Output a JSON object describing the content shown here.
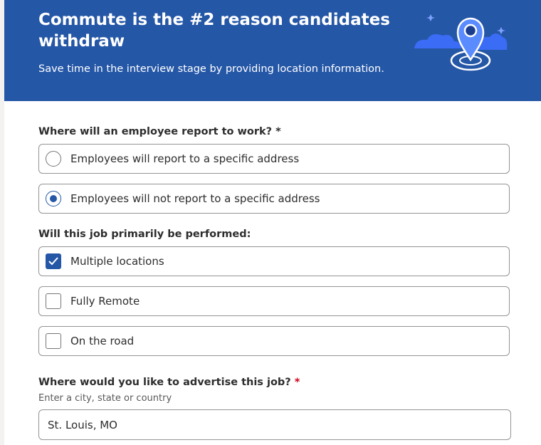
{
  "banner": {
    "title": "Commute is the #2 reason candidates withdraw",
    "subtitle": "Save time in the interview stage by providing location information.",
    "illustration": "location-pin-icon",
    "colors": {
      "background": "#2557a7",
      "pin": "#5b8cff",
      "cloud": "#3b6cf5"
    }
  },
  "report_question": {
    "label": "Where will an employee report to work?",
    "required_marker": "*",
    "options": [
      {
        "label": "Employees will report to a specific address",
        "selected": false
      },
      {
        "label": "Employees will not report to a specific address",
        "selected": true
      }
    ]
  },
  "performed_question": {
    "label": "Will this job primarily be performed:",
    "options": [
      {
        "label": "Multiple locations",
        "checked": true
      },
      {
        "label": "Fully Remote",
        "checked": false
      },
      {
        "label": "On the road",
        "checked": false
      }
    ]
  },
  "advertise_question": {
    "label": "Where would you like to advertise this job?",
    "required_marker": "*",
    "hint": "Enter a city, state or country",
    "value": "St. Louis, MO"
  },
  "accent_color": "#2557a7"
}
